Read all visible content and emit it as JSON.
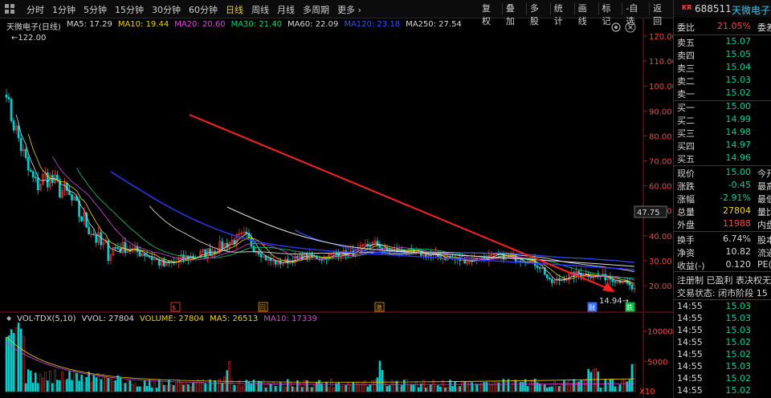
{
  "toolbar": {
    "periods": [
      "分时",
      "1分钟",
      "5分钟",
      "15分钟",
      "30分钟",
      "60分钟",
      "日线",
      "周线",
      "月线",
      "多周期",
      "更多 ›"
    ],
    "active_period": "日线",
    "tools": [
      "复权",
      "叠加",
      "多股",
      "统计",
      "画线",
      "标记",
      "-自选",
      "返回"
    ]
  },
  "ma_bar": {
    "title": "天微电子(日线)",
    "items": [
      {
        "text": "MA5: 17.29",
        "color": "#d8d8d8"
      },
      {
        "text": "MA10: 19.44",
        "color": "#f2d500"
      },
      {
        "text": "MA20: 20.60",
        "color": "#e040e0"
      },
      {
        "text": "MA30: 21.40",
        "color": "#00d080"
      },
      {
        "text": "MA60: 22.09",
        "color": "#d8d8d8"
      },
      {
        "text": "MA120: 23.18",
        "color": "#3050ff"
      },
      {
        "text": "MA250: 27.54",
        "color": "#d8d8d8"
      }
    ]
  },
  "price_axis": [
    "120.00",
    "110.00",
    "100.00",
    "90.00",
    "80.00",
    "70.00",
    "60.00",
    "50.00",
    "40.00",
    "30.00",
    "20.00"
  ],
  "current_price_tag": "47.75",
  "high_label": "122.00",
  "low_label": "14.94",
  "volume_header": {
    "items": [
      {
        "text": "VOL-TDX(5,10)",
        "color": "#d8d8d8"
      },
      {
        "text": "VVOL: 27804",
        "color": "#d8d8d8"
      },
      {
        "text": "VOLUME: 27804",
        "color": "#f2d500"
      },
      {
        "text": "MA5: 26513",
        "color": "#f2d500"
      },
      {
        "text": "MA10: 17339",
        "color": "#e040e0"
      }
    ]
  },
  "volume_axis": [
    "10000",
    "5000",
    "X10"
  ],
  "markers": [
    {
      "text": "$"
    },
    {
      "text": "回"
    },
    {
      "text": "激"
    },
    {
      "text": "财"
    },
    {
      "text": "跌"
    }
  ],
  "right_panel": {
    "badge": "KR",
    "code": "688511",
    "name": "天微电子",
    "weibi_label": "委比",
    "weibi_value": "21.05%",
    "weicha_label": "委差",
    "asks": [
      {
        "label": "卖五",
        "price": "15.07"
      },
      {
        "label": "卖四",
        "price": "15.05"
      },
      {
        "label": "卖三",
        "price": "15.04"
      },
      {
        "label": "卖二",
        "price": "15.03"
      },
      {
        "label": "卖一",
        "price": "15.02"
      }
    ],
    "bids": [
      {
        "label": "买一",
        "price": "15.00"
      },
      {
        "label": "买二",
        "price": "14.99"
      },
      {
        "label": "买三",
        "price": "14.98"
      },
      {
        "label": "买四",
        "price": "14.97"
      },
      {
        "label": "买五",
        "price": "14.96"
      }
    ],
    "quote": [
      {
        "label": "现价",
        "value": "15.00",
        "extra": "今开",
        "color": "g"
      },
      {
        "label": "涨跌",
        "value": "-0.45",
        "extra": "最高",
        "color": "g"
      },
      {
        "label": "涨幅",
        "value": "-2.91%",
        "extra": "最低",
        "color": "g"
      },
      {
        "label": "总量",
        "value": "27804",
        "extra": "量比",
        "color": "y"
      },
      {
        "label": "外盘",
        "value": "11988",
        "extra": "内盘",
        "color": "r"
      }
    ],
    "stats": [
      {
        "label": "换手",
        "value": "6.74%",
        "extra": "股本"
      },
      {
        "label": "净资",
        "value": "10.82",
        "extra": "流通"
      },
      {
        "label": "收益(-)",
        "value": "0.120",
        "extra": "PE("
      }
    ],
    "tags": "注册制 已盈利 表决权无",
    "trade_status": "交易状态: 闭市阶段 15",
    "ticks": [
      {
        "time": "14:55",
        "price": "15.03"
      },
      {
        "time": "14:55",
        "price": "15.03"
      },
      {
        "time": "14:55",
        "price": "15.03"
      },
      {
        "time": "14:55",
        "price": "15.02"
      },
      {
        "time": "14:55",
        "price": "15.02"
      },
      {
        "time": "14:55",
        "price": "15.03"
      },
      {
        "time": "14:55",
        "price": "15.02"
      },
      {
        "time": "14:55",
        "price": "15.02"
      }
    ]
  }
}
